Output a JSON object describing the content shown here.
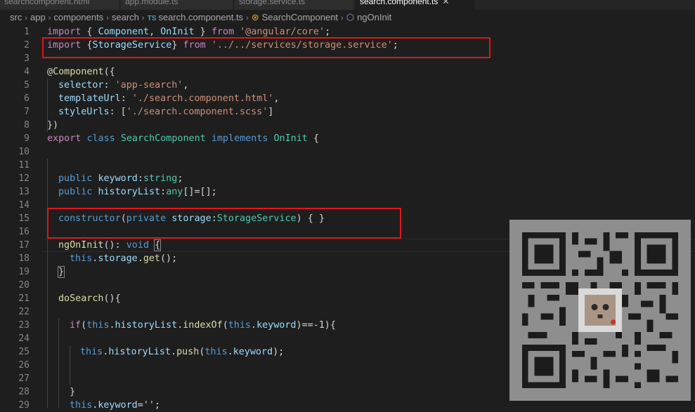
{
  "tabs": [
    {
      "label": "searchcomponent.html",
      "active": false
    },
    {
      "label": "app.module.ts",
      "active": false
    },
    {
      "label": "storage.service.ts",
      "active": false
    },
    {
      "label": "search.component.ts",
      "active": true
    }
  ],
  "breadcrumb": {
    "items": [
      "src",
      "app",
      "components",
      "search"
    ],
    "ts_badge": "TS",
    "file": "search.component.ts",
    "class_name": "SearchComponent",
    "method_name": "ngOnInit"
  },
  "editor": {
    "line_numbers": [
      "1",
      "2",
      "3",
      "4",
      "5",
      "6",
      "7",
      "8",
      "9",
      "10",
      "11",
      "12",
      "13",
      "14",
      "15",
      "16",
      "17",
      "18",
      "19",
      "20",
      "21",
      "22",
      "23",
      "24",
      "25",
      "26",
      "27",
      "28",
      "29"
    ],
    "code": {
      "l1_import": "import",
      "l1_lb": " { ",
      "l1_component": "Component",
      "l1_comma": ", ",
      "l1_oninit": "OnInit",
      "l1_rb": " } ",
      "l1_from": "from",
      "l1_path": "'@angular/core'",
      "l1_semi": ";",
      "l2_import": "import",
      "l2_lb": " {",
      "l2_storage": "StorageService",
      "l2_rb": "} ",
      "l2_from": "from",
      "l2_path": "'../../services/storage.service'",
      "l2_semi": ";",
      "l4_at": "@",
      "l4_component": "Component",
      "l4_paren": "({",
      "l5_selector": "selector",
      "l5_colon": ": ",
      "l5_val": "'app-search'",
      "l5_comma": ",",
      "l6_template": "templateUrl",
      "l6_colon": ": ",
      "l6_val": "'./search.component.html'",
      "l6_comma": ",",
      "l7_style": "styleUrls",
      "l7_colon": ": [",
      "l7_val": "'./search.component.scss'",
      "l7_rb": "]",
      "l8_close": "})",
      "l9_export": "export",
      "l9_class": "class",
      "l9_name": "SearchComponent",
      "l9_implements": "implements",
      "l9_oninit": "OnInit",
      "l9_brace": " {",
      "l12_public": "public",
      "l12_keyword": "keyword",
      "l12_colon": ":",
      "l12_type": "string",
      "l12_semi": ";",
      "l13_public": "public",
      "l13_history": "historyList",
      "l13_colon": ":",
      "l13_type": "any",
      "l13_rest": "[]=[];",
      "l15_constructor": "constructor",
      "l15_lp": "(",
      "l15_private": "private",
      "l15_storage": "storage",
      "l15_colon": ":",
      "l15_type": "StorageService",
      "l15_rest": ") { }",
      "l17_ngoninit": "ngOnInit",
      "l17_parens": "(): ",
      "l17_void": "void",
      "l17_brace": "{",
      "l18_this": "this",
      "l18_dot": ".",
      "l18_storage": "storage",
      "l18_dot2": ".",
      "l18_get": "get",
      "l18_rest": "();",
      "l19_brace": "}",
      "l21_dosearch": "doSearch",
      "l21_rest": "(){",
      "l23_if": "if",
      "l23_lp": "(",
      "l23_this": "this",
      "l23_dot": ".",
      "l23_history": "historyList",
      "l23_dot2": ".",
      "l23_indexof": "indexOf",
      "l23_lp2": "(",
      "l23_this2": "this",
      "l23_dot3": ".",
      "l23_keyword": "keyword",
      "l23_rest": ")==-1){",
      "l25_this": "this",
      "l25_dot": ".",
      "l25_history": "historyList",
      "l25_dot2": ".",
      "l25_push": "push",
      "l25_lp": "(",
      "l25_this2": "this",
      "l25_dot3": ".",
      "l25_keyword": "keyword",
      "l25_rest": ");",
      "l28_brace": "}",
      "l29_this": "this",
      "l29_dot": ".",
      "l29_keyword": "keyword",
      "l29_rest": "='';"
    }
  },
  "colors": {
    "keyword_blue": "#569cd6",
    "control_purple": "#c586c0",
    "string_orange": "#ce9178",
    "type_teal": "#4ec9b0",
    "function_yellow": "#dcdcaa",
    "variable_lightblue": "#9cdcfe",
    "highlight_red": "#e0161a",
    "background": "#1e1e1e"
  },
  "overlay": {
    "icon": "qr-code-icon"
  }
}
